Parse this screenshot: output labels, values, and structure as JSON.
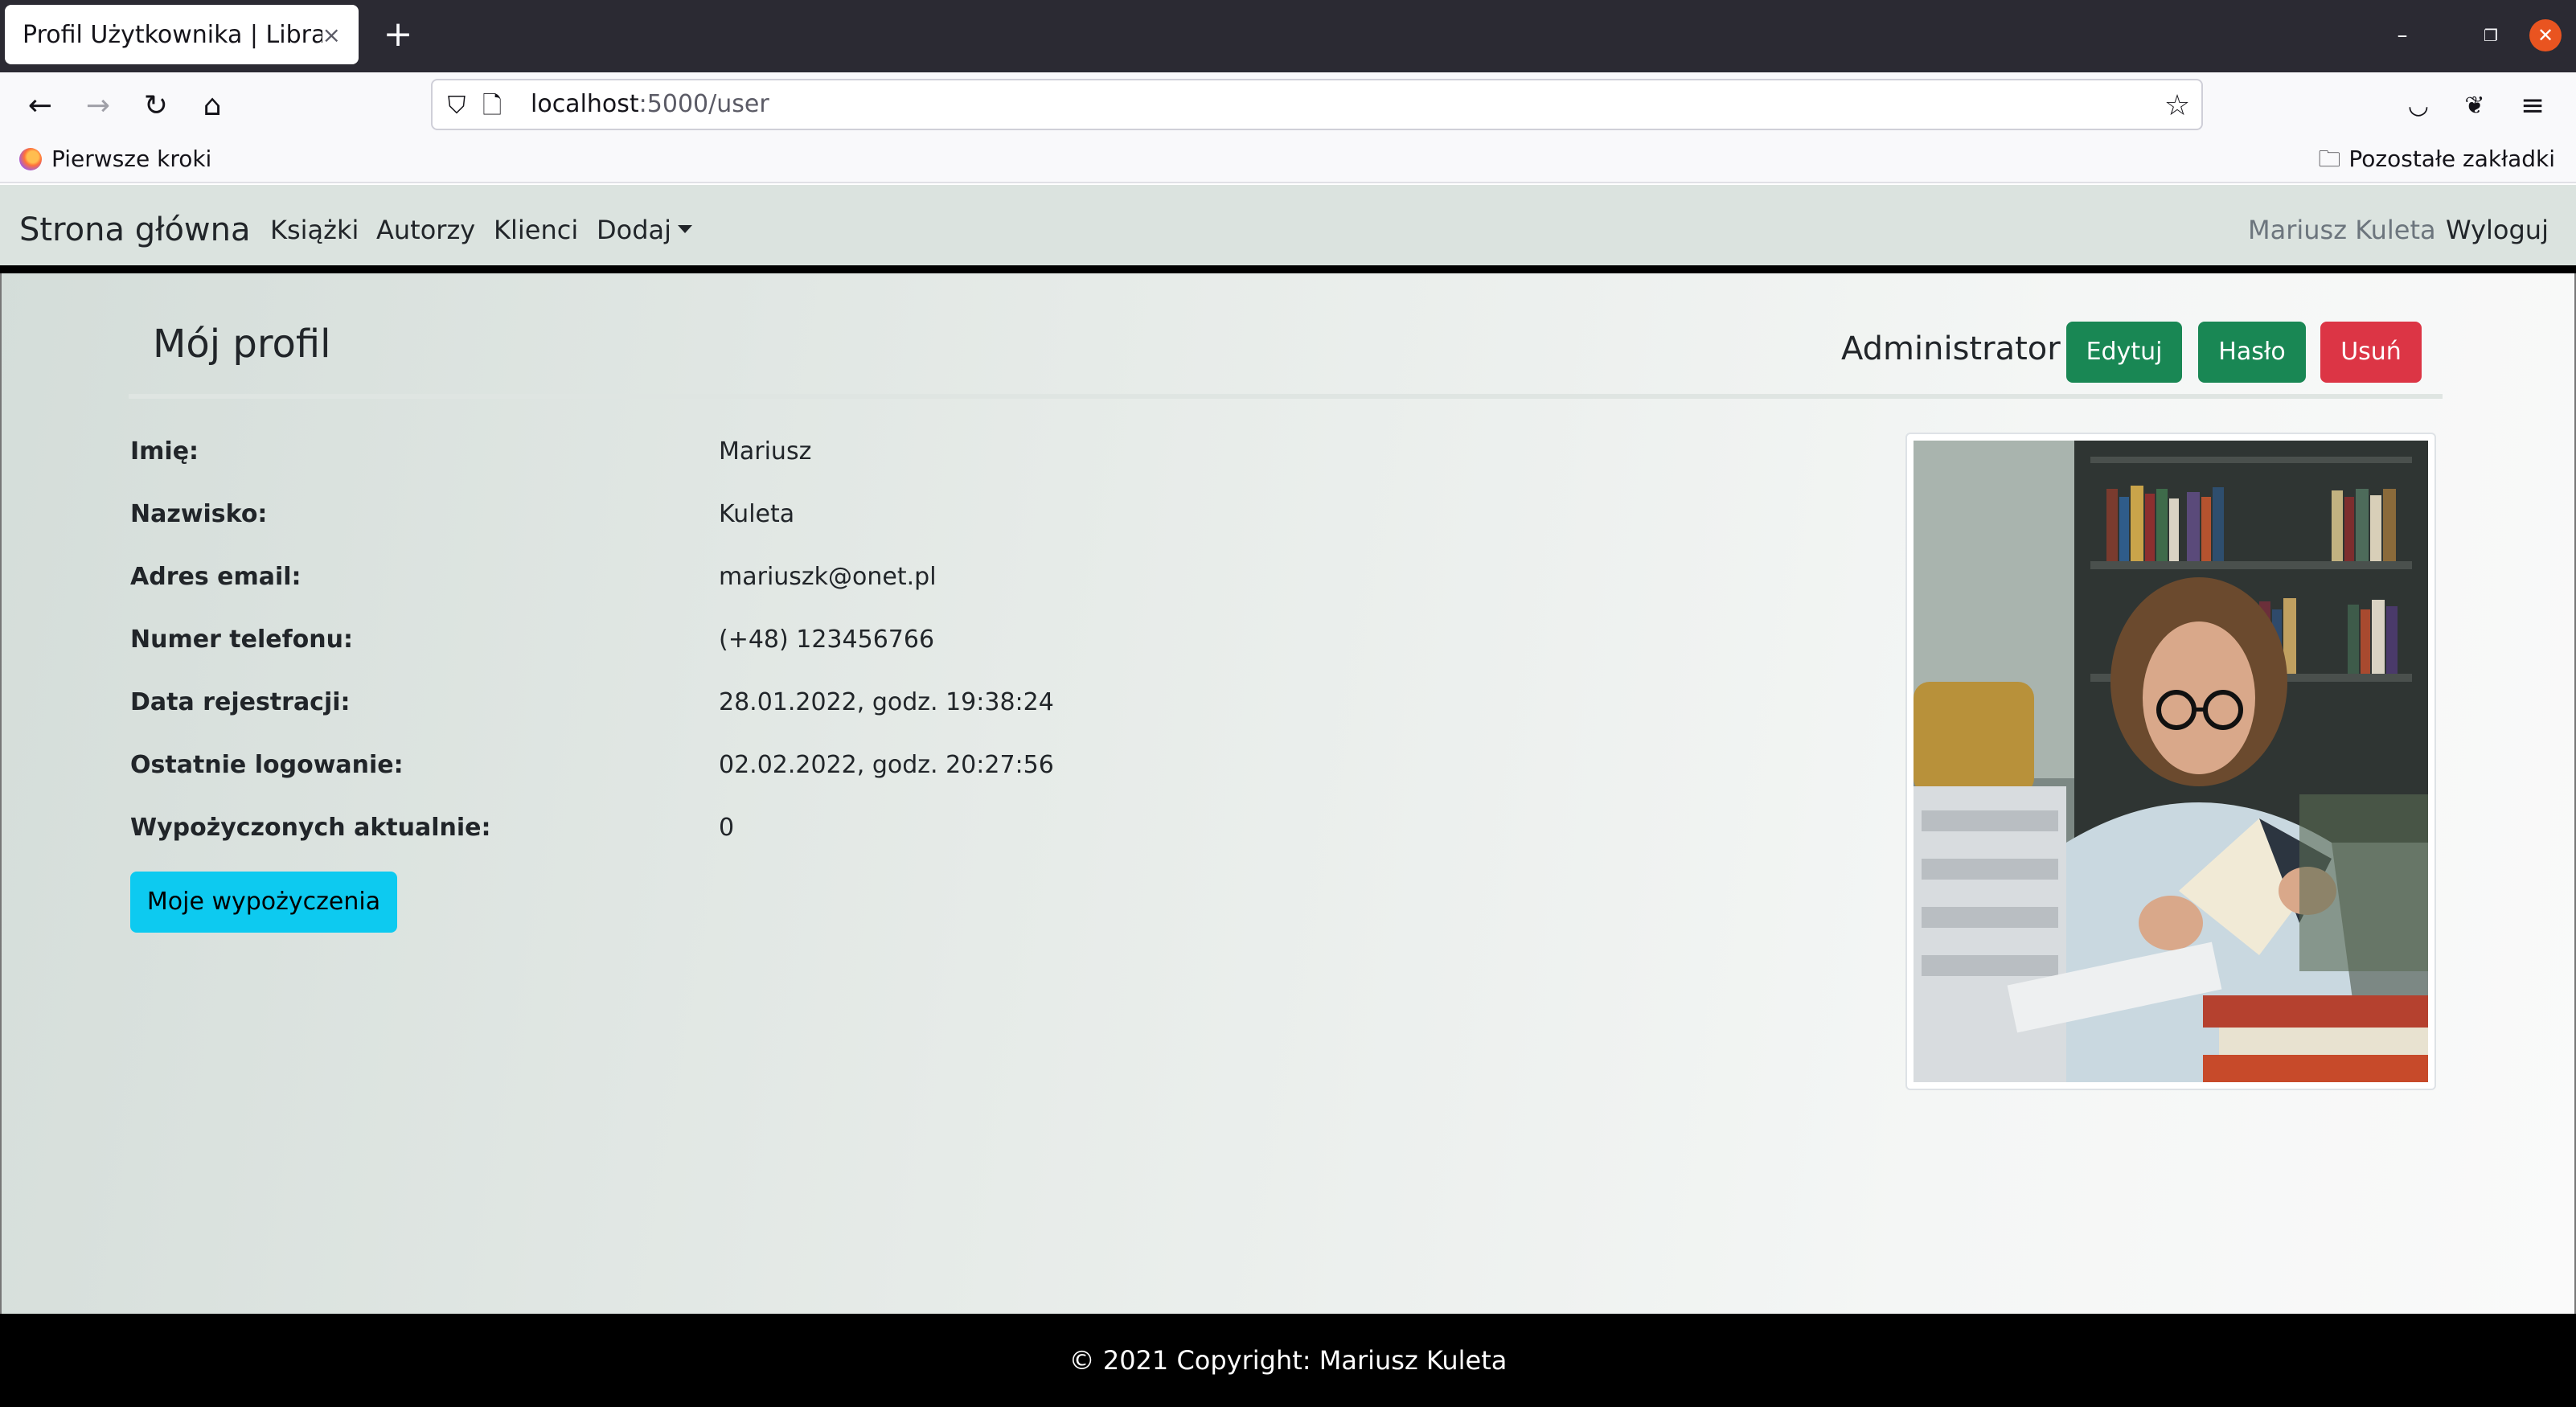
{
  "browser": {
    "tab_title": "Profil Użytkownika | Library",
    "tab_close": "×",
    "new_tab": "+",
    "url_host": "localhost",
    "url_path": ":5000/user",
    "bookmark_left": "Pierwsze kroki",
    "bookmark_right": "Pozostałe zakładki"
  },
  "navbar": {
    "brand": "Strona główna",
    "links": [
      "Książki",
      "Autorzy",
      "Klienci",
      "Dodaj"
    ],
    "user": "Mariusz Kuleta",
    "logout": "Wyloguj"
  },
  "profile": {
    "title": "Mój profil",
    "role": "Administrator",
    "buttons": {
      "edit": "Edytuj",
      "password": "Hasło",
      "delete": "Usuń"
    },
    "fields": [
      {
        "label": "Imię:",
        "value": "Mariusz"
      },
      {
        "label": "Nazwisko:",
        "value": "Kuleta"
      },
      {
        "label": "Adres email:",
        "value": "mariuszk@onet.pl"
      },
      {
        "label": "Numer telefonu:",
        "value": "(+48) 123456766"
      },
      {
        "label": "Data rejestracji:",
        "value": "28.01.2022, godz. 19:38:24"
      },
      {
        "label": "Ostatnie logowanie:",
        "value": "02.02.2022, godz. 20:27:56"
      },
      {
        "label": "Wypożyczonych aktualnie:",
        "value": "0"
      }
    ],
    "loans_button": "Moje wypożyczenia"
  },
  "footer": {
    "text": "© 2021 Copyright: Mariusz Kuleta"
  },
  "colors": {
    "success": "#198754",
    "danger": "#dc3545",
    "info": "#0dcaf0",
    "footer_bg": "#000000"
  }
}
